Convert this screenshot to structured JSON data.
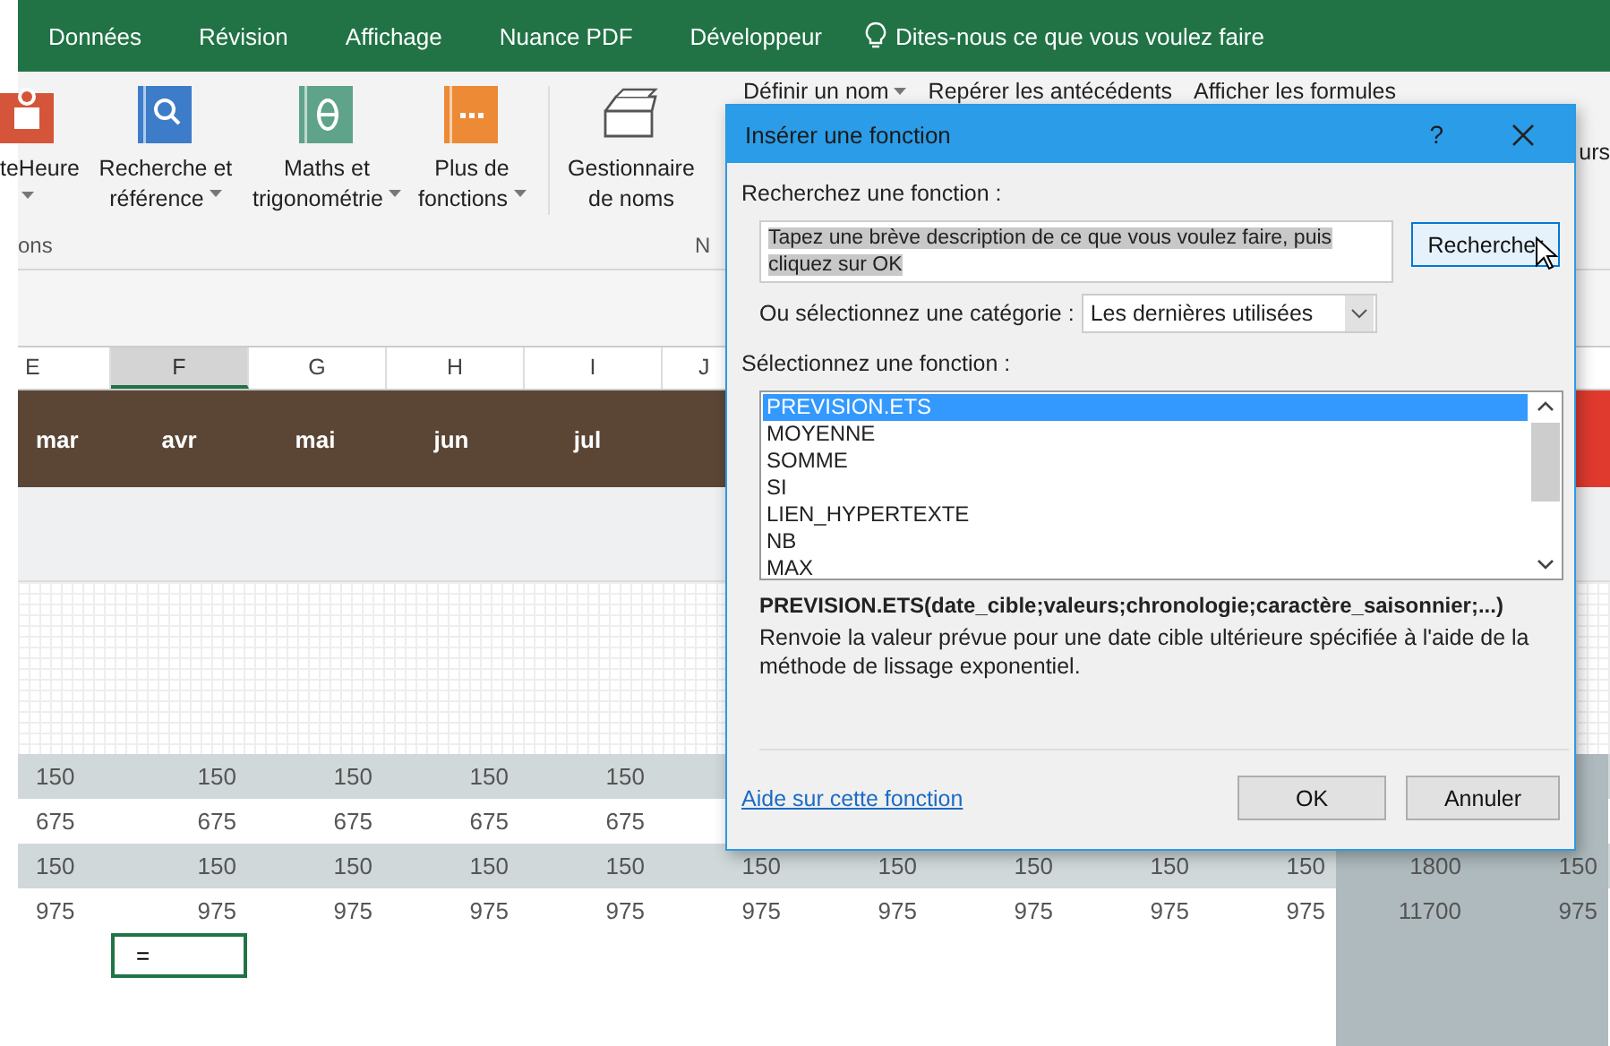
{
  "ribbon_tabs": [
    {
      "label": "Données"
    },
    {
      "label": "Révision"
    },
    {
      "label": "Affichage"
    },
    {
      "label": "Nuance PDF"
    },
    {
      "label": "Développeur"
    }
  ],
  "tell_me": {
    "placeholder": "Dites-nous ce que vous voulez faire"
  },
  "ribbon_buttons": [
    {
      "kind": "calendar",
      "lines": [
        "teHeure"
      ],
      "has_menu": true
    },
    {
      "kind": "search-book",
      "lines": [
        "Recherche et",
        "référence"
      ],
      "has_menu": true
    },
    {
      "kind": "theta-book",
      "lines": [
        "Maths et",
        "trigonométrie"
      ],
      "has_menu": true
    },
    {
      "kind": "dots-book",
      "lines": [
        "Plus de",
        "fonctions"
      ],
      "has_menu": true
    },
    {
      "kind": "names",
      "lines": [
        "Gestionnaire",
        "de noms"
      ],
      "has_menu": false
    }
  ],
  "ribbon_small_buttons": [
    {
      "label": "Définir un nom",
      "has_menu": true
    },
    {
      "label": "Repérer les antécédents",
      "has_menu": false
    },
    {
      "label": "Afficher les formules",
      "has_menu": false
    }
  ],
  "ribbon_cut_text": "urs",
  "group_labels": [
    "ons",
    "N"
  ],
  "sheet": {
    "columns": [
      {
        "label": "E",
        "selected": false
      },
      {
        "label": "F",
        "selected": true
      },
      {
        "label": "G",
        "selected": false
      },
      {
        "label": "H",
        "selected": false
      },
      {
        "label": "I",
        "selected": false
      },
      {
        "label": "J",
        "selected": false
      }
    ],
    "months": [
      "mar",
      "avr",
      "mai",
      "jun",
      "jul"
    ],
    "rows": [
      {
        "shaded": true,
        "cells": [
          "150",
          "150",
          "150",
          "150",
          "150"
        ]
      },
      {
        "shaded": false,
        "cells": [
          "675",
          "675",
          "675",
          "675",
          "675"
        ]
      },
      {
        "shaded": true,
        "cells": [
          "150",
          "150",
          "150",
          "150",
          "150",
          "150",
          "150",
          "150",
          "150",
          "150",
          "1800",
          "150"
        ]
      },
      {
        "shaded": false,
        "cells": [
          "975",
          "975",
          "975",
          "975",
          "975",
          "975",
          "975",
          "975",
          "975",
          "975",
          "11700",
          "975"
        ]
      }
    ],
    "active_cell": {
      "value": "="
    }
  },
  "dialog": {
    "title": "Insérer une fonction",
    "help": "?",
    "search_label": "Recherchez une fonction :",
    "search_value": "Tapez une brève description de ce que vous voulez faire, puis cliquez sur OK",
    "search_button": "Rechercher",
    "category_label": "Ou sélectionnez une catégorie :",
    "category_value": "Les dernières utilisées",
    "list_label": "Sélectionnez une fonction :",
    "functions": [
      {
        "name": "PREVISION.ETS",
        "selected": true
      },
      {
        "name": "MOYENNE",
        "selected": false
      },
      {
        "name": "SOMME",
        "selected": false
      },
      {
        "name": "SI",
        "selected": false
      },
      {
        "name": "LIEN_HYPERTEXTE",
        "selected": false
      },
      {
        "name": "NB",
        "selected": false
      },
      {
        "name": "MAX",
        "selected": false
      }
    ],
    "signature": "PREVISION.ETS(date_cible;valeurs;chronologie;caractère_saisonnier;...)",
    "description": "Renvoie la valeur prévue pour une date cible ultérieure spécifiée à l'aide de la méthode de lissage exponentiel.",
    "help_link": "Aide sur cette fonction",
    "buttons": [
      "OK",
      "Annuler"
    ]
  }
}
